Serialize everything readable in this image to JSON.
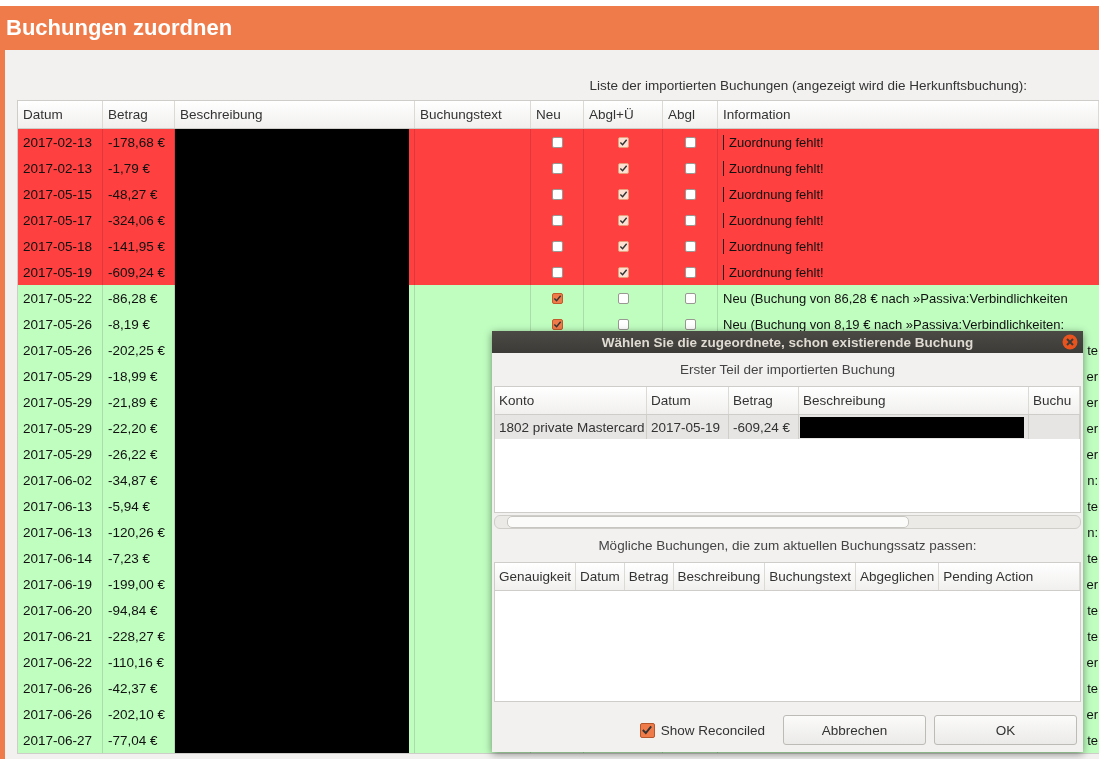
{
  "window": {
    "title": "Buchungen zuordnen"
  },
  "list_caption": "Liste der importierten Buchungen (angezeigt wird die Herkunftsbuchung):",
  "table": {
    "columns": [
      "Datum",
      "Betrag",
      "Beschreibung",
      "Buchungstext",
      "Neu",
      "Abgl+Ü",
      "Abgl",
      "Information"
    ],
    "rows": [
      {
        "kind": "missing",
        "date": "2017-02-13",
        "amount": "-178,68 €",
        "new": false,
        "reconcile_update": true,
        "reconcile": false,
        "information": "Zuordnung fehlt!"
      },
      {
        "kind": "missing",
        "date": "2017-02-13",
        "amount": "-1,79 €",
        "new": false,
        "reconcile_update": true,
        "reconcile": false,
        "information": "Zuordnung fehlt!"
      },
      {
        "kind": "missing",
        "date": "2017-05-15",
        "amount": "-48,27 €",
        "new": false,
        "reconcile_update": true,
        "reconcile": false,
        "information": "Zuordnung fehlt!"
      },
      {
        "kind": "missing",
        "date": "2017-05-17",
        "amount": "-324,06 €",
        "new": false,
        "reconcile_update": true,
        "reconcile": false,
        "information": "Zuordnung fehlt!"
      },
      {
        "kind": "missing",
        "date": "2017-05-18",
        "amount": "-141,95 €",
        "new": false,
        "reconcile_update": true,
        "reconcile": false,
        "information": "Zuordnung fehlt!"
      },
      {
        "kind": "missing",
        "date": "2017-05-19",
        "amount": "-609,24 €",
        "new": false,
        "reconcile_update": true,
        "reconcile": false,
        "information": "Zuordnung fehlt!"
      },
      {
        "kind": "new",
        "date": "2017-05-22",
        "amount": "-86,28 €",
        "new": true,
        "reconcile_update": false,
        "reconcile": false,
        "information": "Neu (Buchung von 86,28 € nach »Passiva:Verbindlichkeiten"
      },
      {
        "kind": "new",
        "date": "2017-05-26",
        "amount": "-8,19 €",
        "new": true,
        "reconcile_update": false,
        "reconcile": false,
        "information": "Neu (Buchung von 8,19 € nach »Passiva:Verbindlichkeiten:"
      },
      {
        "kind": "new",
        "date": "2017-05-26",
        "amount": "-202,25 €",
        "information_tail": "te"
      },
      {
        "kind": "new",
        "date": "2017-05-29",
        "amount": "-18,99 €",
        "information_tail": "er"
      },
      {
        "kind": "new",
        "date": "2017-05-29",
        "amount": "-21,89 €",
        "information_tail": "er"
      },
      {
        "kind": "new",
        "date": "2017-05-29",
        "amount": "-22,20 €",
        "information_tail": "er"
      },
      {
        "kind": "new",
        "date": "2017-05-29",
        "amount": "-26,22 €",
        "information_tail": "er"
      },
      {
        "kind": "new",
        "date": "2017-06-02",
        "amount": "-34,87 €",
        "information_tail": "n:"
      },
      {
        "kind": "new",
        "date": "2017-06-13",
        "amount": "-5,94 €",
        "information_tail": "te"
      },
      {
        "kind": "new",
        "date": "2017-06-13",
        "amount": "-120,26 €",
        "information_tail": "n:"
      },
      {
        "kind": "new",
        "date": "2017-06-14",
        "amount": "-7,23 €",
        "information_tail": "te"
      },
      {
        "kind": "new",
        "date": "2017-06-19",
        "amount": "-199,00 €",
        "information_tail": "er"
      },
      {
        "kind": "new",
        "date": "2017-06-20",
        "amount": "-94,84 €",
        "information_tail": "te"
      },
      {
        "kind": "new",
        "date": "2017-06-21",
        "amount": "-228,27 €",
        "information_tail": "te"
      },
      {
        "kind": "new",
        "date": "2017-06-22",
        "amount": "-110,16 €",
        "information_tail": "er"
      },
      {
        "kind": "new",
        "date": "2017-06-26",
        "amount": "-42,37 €",
        "information_tail": "te"
      },
      {
        "kind": "new",
        "date": "2017-06-26",
        "amount": "-202,10 €",
        "information_tail": "er"
      },
      {
        "kind": "new",
        "date": "2017-06-27",
        "amount": "-77,04 €",
        "information_tail": "te"
      }
    ]
  },
  "dialog": {
    "title": "Wählen Sie die zugeordnete, schon existierende Buchung",
    "first_caption": "Erster Teil der importierten Buchung",
    "first_table": {
      "columns": [
        "Konto",
        "Datum",
        "Betrag",
        "Beschreibung",
        "Buchu"
      ],
      "rows": [
        {
          "account": "1802 private Mastercard",
          "date": "2017-05-19",
          "amount": "-609,24 €",
          "selected": true
        }
      ]
    },
    "second_caption": "Mögliche Buchungen, die zum aktuellen Buchungssatz passen:",
    "second_table": {
      "columns": [
        "Genauigkeit",
        "Datum",
        "Betrag",
        "Beschreibung",
        "Buchungstext",
        "Abgeglichen",
        "Pending Action"
      ]
    },
    "show_reconciled": {
      "label": "Show Reconciled",
      "checked": true
    },
    "buttons": [
      "Abbrechen",
      "OK"
    ]
  }
}
